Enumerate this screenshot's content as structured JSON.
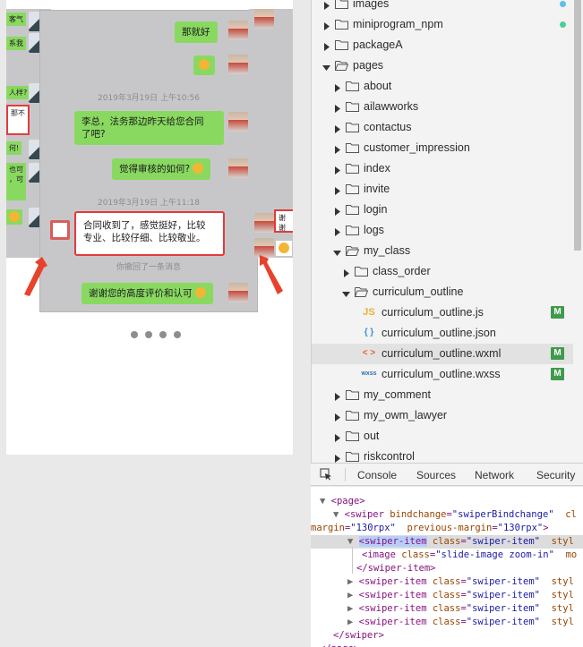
{
  "simulator": {
    "current": {
      "msg_deal": "那就好",
      "time1": "2019年3月19日 上午10:56",
      "msg_question": "李总，法务那边昨天给您合同\n了吧?",
      "msg_review": "觉得审核的如何?",
      "time2": "2019年3月19日 上午11:18",
      "msg_contract": "合同收到了，感觉挺好，比较\n专业、比较仔细、比较敬业。",
      "recall": "你撤回了一条消息",
      "msg_thanks": "谢谢您的高度评价和认可"
    },
    "prev_fragments": [
      "客气",
      "系我",
      "人样?",
      "那不",
      "何!",
      "也可\n，可"
    ],
    "next_fragment": "谢谢",
    "pagination_dots": 4,
    "colors": {
      "bubble_green": "#89d961",
      "highlight_red": "#e23b3b"
    }
  },
  "file_tree": {
    "items": [
      {
        "name": "images",
        "type": "folder",
        "expanded": false,
        "level": 0,
        "status": "blue-dot"
      },
      {
        "name": "miniprogram_npm",
        "type": "folder",
        "expanded": false,
        "level": 0,
        "status": "green-dot"
      },
      {
        "name": "packageA",
        "type": "folder",
        "expanded": false,
        "level": 0
      },
      {
        "name": "pages",
        "type": "folder",
        "expanded": true,
        "level": 0
      },
      {
        "name": "about",
        "type": "folder",
        "expanded": false,
        "level": 1
      },
      {
        "name": "ailawworks",
        "type": "folder",
        "expanded": false,
        "level": 1
      },
      {
        "name": "contactus",
        "type": "folder",
        "expanded": false,
        "level": 1
      },
      {
        "name": "customer_impression",
        "type": "folder",
        "expanded": false,
        "level": 1
      },
      {
        "name": "index",
        "type": "folder",
        "expanded": false,
        "level": 1
      },
      {
        "name": "invite",
        "type": "folder",
        "expanded": false,
        "level": 1
      },
      {
        "name": "login",
        "type": "folder",
        "expanded": false,
        "level": 1
      },
      {
        "name": "logs",
        "type": "folder",
        "expanded": false,
        "level": 1
      },
      {
        "name": "my_class",
        "type": "folder",
        "expanded": true,
        "level": 1
      },
      {
        "name": "class_order",
        "type": "folder",
        "expanded": false,
        "level": 2
      },
      {
        "name": "curriculum_outline",
        "type": "folder",
        "expanded": true,
        "level": 2
      },
      {
        "name": "curriculum_outline.js",
        "type": "file",
        "icon": "JS",
        "kind": "js",
        "level": 3,
        "badge": "M"
      },
      {
        "name": "curriculum_outline.json",
        "type": "file",
        "icon": "{ }",
        "kind": "json",
        "level": 3
      },
      {
        "name": "curriculum_outline.wxml",
        "type": "file",
        "icon": "< >",
        "kind": "wxml",
        "level": 3,
        "badge": "M",
        "selected": true
      },
      {
        "name": "curriculum_outline.wxss",
        "type": "file",
        "icon": "wxss",
        "kind": "wxss",
        "level": 3,
        "badge": "M"
      },
      {
        "name": "my_comment",
        "type": "folder",
        "expanded": false,
        "level": 1
      },
      {
        "name": "my_owm_lawyer",
        "type": "folder",
        "expanded": false,
        "level": 1
      },
      {
        "name": "out",
        "type": "folder",
        "expanded": false,
        "level": 1
      },
      {
        "name": "riskcontrol",
        "type": "folder",
        "expanded": false,
        "level": 1
      }
    ],
    "colors": {
      "badge_green": "#3f9a4d",
      "dot_blue": "#5bc0eb",
      "dot_green": "#4ccf9a"
    }
  },
  "devtools": {
    "tabs": [
      "Console",
      "Sources",
      "Network",
      "Security"
    ],
    "lines": [
      {
        "tri": "▼",
        "parts": [
          [
            "tg",
            "<page>"
          ]
        ]
      },
      {
        "tri": "▼",
        "parts": [
          [
            "tg",
            "<swiper"
          ],
          [
            "an",
            " bindchange"
          ],
          [
            "tg",
            "="
          ],
          [
            "av",
            "\"swiperBindchange\""
          ],
          [
            "an",
            "  cl"
          ]
        ]
      },
      {
        "tri": "",
        "parts": [
          [
            "an",
            "margin"
          ],
          [
            "tg",
            "="
          ],
          [
            "av",
            "\"130rpx\""
          ],
          [
            "an",
            "  previous-margin"
          ],
          [
            "tg",
            "="
          ],
          [
            "av",
            "\"130rpx\""
          ],
          [
            "tg",
            ">"
          ]
        ]
      },
      {
        "tri": "▼",
        "parts": [
          [
            "sel",
            "<swiper-item"
          ],
          [
            "an",
            " class"
          ],
          [
            "tg",
            "="
          ],
          [
            "av",
            "\"swiper-item\""
          ],
          [
            "an",
            "  styl"
          ]
        ],
        "highlight": true
      },
      {
        "tri": "",
        "parts": [
          [
            "tg",
            "<image"
          ],
          [
            "an",
            " class"
          ],
          [
            "tg",
            "="
          ],
          [
            "av",
            "\"slide-image zoom-in\""
          ],
          [
            "an",
            "  mo"
          ]
        ]
      },
      {
        "tri": "",
        "parts": [
          [
            "tg",
            "</swiper-item>"
          ]
        ]
      },
      {
        "tri": "▶",
        "parts": [
          [
            "tg",
            "<swiper-item"
          ],
          [
            "an",
            " class"
          ],
          [
            "tg",
            "="
          ],
          [
            "av",
            "\"swiper-item\""
          ],
          [
            "an",
            "  styl"
          ]
        ]
      },
      {
        "tri": "▶",
        "parts": [
          [
            "tg",
            "<swiper-item"
          ],
          [
            "an",
            " class"
          ],
          [
            "tg",
            "="
          ],
          [
            "av",
            "\"swiper-item\""
          ],
          [
            "an",
            "  styl"
          ]
        ]
      },
      {
        "tri": "▶",
        "parts": [
          [
            "tg",
            "<swiper-item"
          ],
          [
            "an",
            " class"
          ],
          [
            "tg",
            "="
          ],
          [
            "av",
            "\"swiper-item\""
          ],
          [
            "an",
            "  styl"
          ]
        ]
      },
      {
        "tri": "▶",
        "parts": [
          [
            "tg",
            "<swiper-item"
          ],
          [
            "an",
            " class"
          ],
          [
            "tg",
            "="
          ],
          [
            "av",
            "\"swiper-item\""
          ],
          [
            "an",
            "  styl"
          ]
        ]
      },
      {
        "tri": "",
        "parts": [
          [
            "tg",
            "</swiper>"
          ]
        ]
      },
      {
        "tri": "",
        "parts": [
          [
            "tg",
            "</page>"
          ]
        ]
      }
    ]
  }
}
